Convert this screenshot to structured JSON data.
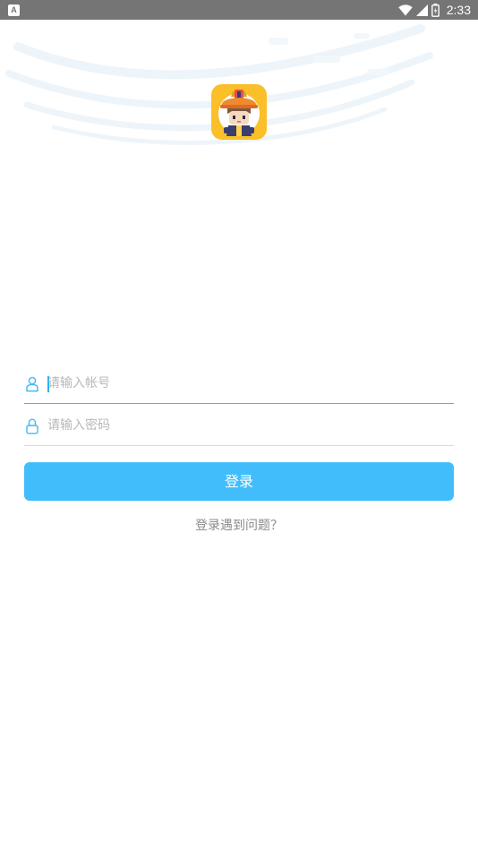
{
  "status_bar": {
    "notification_icon": "a-badge-icon",
    "time": "2:33",
    "icons": [
      "wifi-icon",
      "signal-icon",
      "battery-icon"
    ]
  },
  "app": {
    "logo_icon": "firefighter-mascot-logo",
    "accent_color": "#42bdfb"
  },
  "login_form": {
    "account_placeholder": "请输入帐号",
    "account_value": "",
    "password_placeholder": "请输入密码",
    "password_value": "",
    "submit_label": "登录",
    "help_link": "登录遇到问题？"
  },
  "status_bar_badge": "A"
}
